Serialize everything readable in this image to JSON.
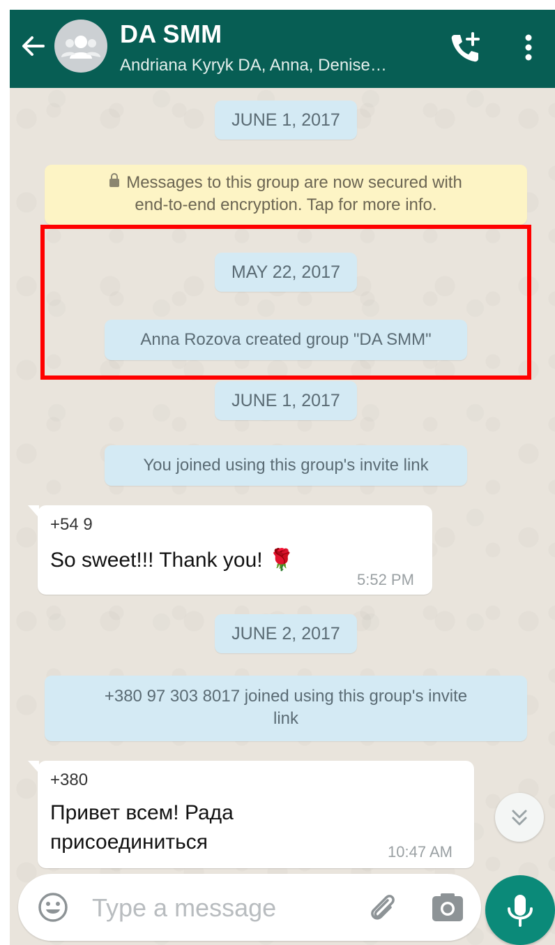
{
  "header": {
    "title": "DA SMM",
    "subtitle": "Andriana Kyryk DA, Anna, Denise…",
    "back_icon": "arrow-left-icon",
    "avatar_icon": "group-avatar-icon",
    "call_icon": "add-call-icon",
    "menu_icon": "more-vertical-icon"
  },
  "chat": {
    "date_1": "JUNE 1, 2017",
    "encryption_notice": {
      "line1": "Messages to this group are now secured with",
      "line2": "end-to-end encryption. Tap for more info."
    },
    "date_2": "MAY 22, 2017",
    "system_created": "Anna Rozova created group \"DA SMM\"",
    "date_3": "JUNE 1, 2017",
    "system_joined_self": "You joined using this group's invite link",
    "message_1": {
      "sender": "+54 9",
      "text": "So sweet!!! Thank you! 🌹",
      "time": "5:52 PM"
    },
    "date_4": "JUNE 2, 2017",
    "system_joined_other": {
      "line1": "+380 97 303 8017 joined using this group's invite",
      "line2": "link"
    },
    "message_2": {
      "sender": "+380",
      "line1": "Привет всем! Рада",
      "line2": "присоединиться",
      "time": "10:47 AM"
    }
  },
  "composer": {
    "placeholder": "Type a message",
    "emoji_icon": "emoji-icon",
    "attach_icon": "paperclip-icon",
    "camera_icon": "camera-icon",
    "mic_icon": "microphone-icon",
    "scroll_icon": "double-chevron-down-icon"
  },
  "colors": {
    "header": "#075e54",
    "accent": "#0b8a79",
    "date_pill": "#d4eaf4",
    "notice": "#fdf4c5",
    "highlight": "#ff0000"
  }
}
